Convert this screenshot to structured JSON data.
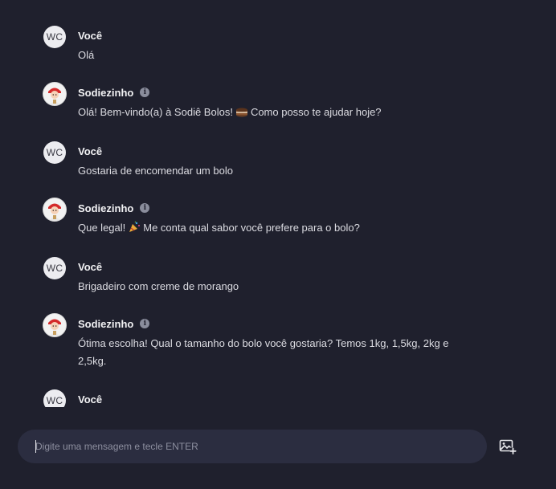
{
  "messages": [
    {
      "sender": "user",
      "name": "Você",
      "initials": "WC",
      "text": "Olá"
    },
    {
      "sender": "bot",
      "name": "Sodiezinho",
      "icon": "info-icon",
      "text_parts": [
        "Olá! Bem-vindo(a) à Sodiê Bolos!",
        "Como posso te ajudar hoje?"
      ],
      "emoji": "cake-icon"
    },
    {
      "sender": "user",
      "name": "Você",
      "initials": "WC",
      "text": "Gostaria de encomendar um bolo"
    },
    {
      "sender": "bot",
      "name": "Sodiezinho",
      "icon": "info-icon",
      "text_parts": [
        "Que legal!",
        "Me conta qual sabor você prefere para o bolo?"
      ],
      "emoji": "party-popper-icon"
    },
    {
      "sender": "user",
      "name": "Você",
      "initials": "WC",
      "text": "Brigadeiro com creme de morango"
    },
    {
      "sender": "bot",
      "name": "Sodiezinho",
      "icon": "info-icon",
      "text": "Ótima escolha! Qual o tamanho do bolo você gostaria? Temos 1kg, 1,5kg, 2kg e 2,5kg."
    },
    {
      "sender": "user",
      "name": "Você",
      "initials": "WC",
      "text": ""
    }
  ],
  "composer": {
    "placeholder": "Digite uma mensagem e tecle ENTER",
    "value": "",
    "attach_icon": "add-image-icon"
  },
  "colors": {
    "background": "#1f202d",
    "input_background": "#2b2d40",
    "bot_avatar_accent": "#d42a2a"
  }
}
